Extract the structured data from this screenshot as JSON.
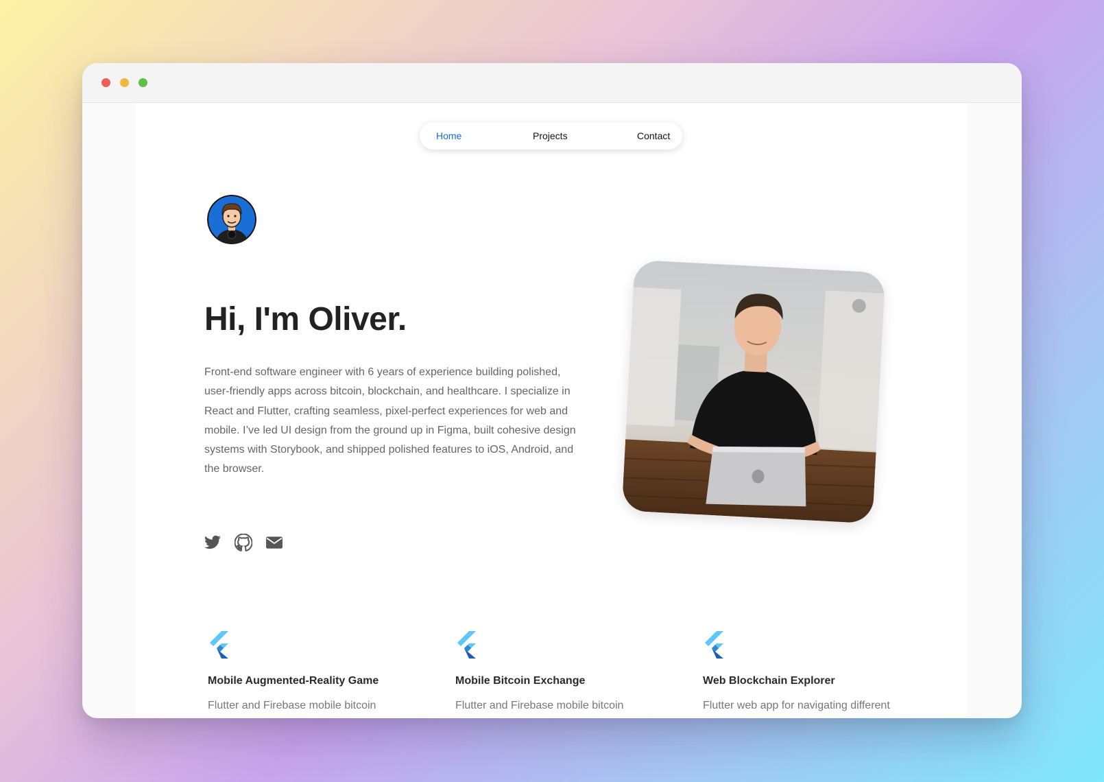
{
  "nav": {
    "items": [
      {
        "label": "Home",
        "active": true
      },
      {
        "label": "Projects",
        "active": false
      },
      {
        "label": "Contact",
        "active": false
      }
    ],
    "active_color": "#1a66e8"
  },
  "hero": {
    "title": "Hi, I'm Oliver.",
    "description": "Front-end software engineer with 6 years of experience building polished, user-friendly apps across bitcoin, blockchain, and healthcare. I specialize in React and Flutter, crafting seamless, pixel-perfect experiences for web and mobile. I’ve led UI design from the ground up in Figma, built cohesive design systems with Storybook, and shipped polished features to iOS, Android, and the browser."
  },
  "social": [
    {
      "icon": "twitter-icon"
    },
    {
      "icon": "github-icon"
    },
    {
      "icon": "email-icon"
    }
  ],
  "projects": [
    {
      "icon": "flutter-logo-icon",
      "title": "Mobile Augmented-Reality Game",
      "description": "Flutter and Firebase mobile bitcoin"
    },
    {
      "icon": "flutter-logo-icon",
      "title": "Mobile Bitcoin Exchange",
      "description": "Flutter and Firebase mobile bitcoin"
    },
    {
      "icon": "flutter-logo-icon",
      "title": "Web Blockchain Explorer",
      "description": "Flutter web app for navigating different"
    }
  ],
  "window_controls": [
    "close",
    "minimize",
    "maximize"
  ]
}
